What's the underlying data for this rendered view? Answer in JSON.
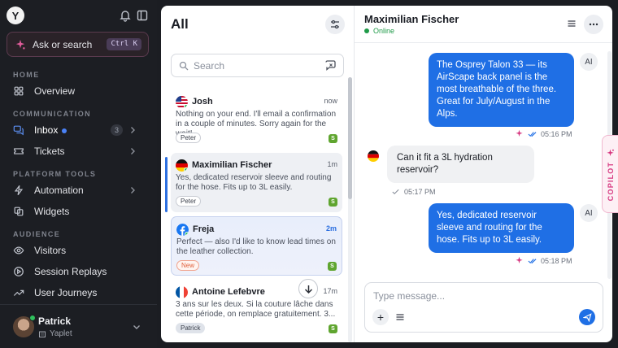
{
  "sidebar": {
    "logo": "Y",
    "ask_label": "Ask or search",
    "ask_shortcut": "Ctrl K",
    "sections": {
      "home": "HOME",
      "communication": "COMMUNICATION",
      "platform_tools": "PLATFORM TOOLS",
      "audience": "AUDIENCE"
    },
    "items": [
      {
        "label": "Overview",
        "icon": "grid-icon"
      },
      {
        "label": "Inbox",
        "icon": "chat-bubbles-icon",
        "badge": "3",
        "active": true
      },
      {
        "label": "Tickets",
        "icon": "ticket-icon"
      },
      {
        "label": "Automation",
        "icon": "lightning-icon"
      },
      {
        "label": "Widgets",
        "icon": "widgets-icon"
      },
      {
        "label": "Visitors",
        "icon": "eye-icon"
      },
      {
        "label": "Session Replays",
        "icon": "play-circle-icon"
      },
      {
        "label": "User Journeys",
        "icon": "trend-up-icon"
      }
    ],
    "user": {
      "name": "Patrick",
      "org": "Yaplet"
    }
  },
  "list": {
    "title": "All",
    "search_placeholder": "Search",
    "conversations": [
      {
        "name": "Josh",
        "time": "now",
        "preview": "Nothing on your end. I'll email a confirmation in a couple of minutes. Sorry again for the wait!",
        "tag": "Peter",
        "flag": "us"
      },
      {
        "name": "Maximilian Fischer",
        "time": "1m",
        "preview": "Yes, dedicated reservoir sleeve and routing for the hose. Fits up to 3L easily.",
        "tag": "Peter",
        "flag": "de"
      },
      {
        "name": "Freja",
        "time": "2m",
        "preview": "Perfect — also I'd like to know lead times on the leather collection.",
        "tag": "New",
        "flag": "facebook"
      },
      {
        "name": "Antoine Lefebvre",
        "time": "17m",
        "preview": "3 ans sur les deux. Si la couture lâche dans cette période, on remplace gratuitement. 3...",
        "tag": "Patrick",
        "flag": "fr"
      }
    ]
  },
  "chat": {
    "name": "Maximilian Fischer",
    "status": "Online",
    "messages": [
      {
        "from": "agent",
        "text": "The Osprey Talon 33 — its AirScape back panel is the most breathable of the three. Great for July/August in the Alps.",
        "time": "05:16 PM",
        "avatar": "AI"
      },
      {
        "from": "user",
        "text": "Can it fit a 3L hydration reservoir?",
        "time": "05:17 PM"
      },
      {
        "from": "agent",
        "text": "Yes, dedicated reservoir sleeve and routing for the hose. Fits up to 3L easily.",
        "time": "05:18 PM",
        "avatar": "AI"
      }
    ],
    "composer_placeholder": "Type message..."
  },
  "copilot": {
    "label": "COPILOT"
  },
  "colors": {
    "accent": "#1f6fe5",
    "online": "#1f9a48",
    "copilot": "#d6367f",
    "sidebar_bg": "#1c1e23"
  }
}
